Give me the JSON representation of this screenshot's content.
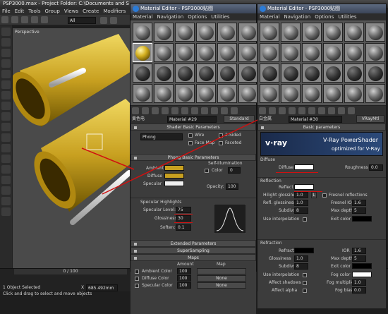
{
  "main": {
    "title": "PSP3000.max    - Project Folder: C:\\Documents and S",
    "menu": [
      "File",
      "Edit",
      "Tools",
      "Group",
      "Views",
      "Create",
      "Modifiers",
      "rea"
    ],
    "viewport_label": "Perspective",
    "view_dropdown": "All"
  },
  "status": {
    "selected": "1 Object Selected",
    "hint": "Click and drag to select and move objects",
    "timeline": "0 / 100",
    "x_value": "685.492mm",
    "x_label": "X"
  },
  "editor1": {
    "title": "Material Editor - PSP3000贴图",
    "menu": [
      "Material",
      "Navigation",
      "Options",
      "Utilities"
    ],
    "name": "黄色电",
    "material": "Material #29",
    "type": "Standard",
    "shader": {
      "header": "Shader Basic Parameters",
      "shader": "Phong",
      "wire": "Wire",
      "two_sided": "2-Sided",
      "face_map": "Face Map",
      "faceted": "Faceted"
    },
    "basic": {
      "header": "Phong Basic Parameters",
      "self_illum": "Self-Illumination",
      "color": "Color",
      "color_val": "0",
      "ambient": "Ambient",
      "diffuse": "Diffuse",
      "specular": "Specular",
      "opacity": "Opacity:",
      "opacity_val": "100"
    },
    "spec": {
      "header": "Specular Highlights",
      "level": "Specular Level:",
      "level_val": "75",
      "gloss": "Glossiness:",
      "gloss_val": "30",
      "soften": "Soften:",
      "soften_val": "0.1"
    },
    "extended": "Extended Parameters",
    "supersampling": "SuperSampling",
    "maps": {
      "header": "Maps",
      "amount": "Amount",
      "map": "Map",
      "rows": [
        {
          "label": "Ambient Color",
          "val": "100",
          "map": ""
        },
        {
          "label": "Diffuse Color",
          "val": "100",
          "map": "None"
        },
        {
          "label": "Specular Color",
          "val": "100",
          "map": "None"
        }
      ]
    }
  },
  "editor2": {
    "title": "Material Editor - PSP3000贴图",
    "menu": [
      "Material",
      "Navigation",
      "Options",
      "Utilities"
    ],
    "name": "白金属",
    "material": "Material #30",
    "type": "VRayMtl",
    "header": "Basic parameters",
    "vray_title": "V-Ray PowerShader",
    "vray_sub": "optimized for V-Ray",
    "vray_logo": "v·ray",
    "diffuse": {
      "section": "Diffuse",
      "label": "Diffuse",
      "rough": "Roughness",
      "rough_val": "0.0"
    },
    "reflection": {
      "section": "Reflection",
      "reflect": "Reflect",
      "hilight": "Hilight glossiness",
      "hilight_val": "1.0",
      "l": "L",
      "fresnel": "Fresnel reflections",
      "refl_gloss": "Refl. glossiness",
      "refl_gloss_val": "1.0",
      "fresnel_ior": "Fresnel IOR",
      "fresnel_ior_val": "1.6",
      "subdivs": "Subdivs",
      "subdivs_val": "8",
      "max_depth": "Max depth",
      "max_depth_val": "5",
      "use_interp": "Use interpolation",
      "exit_color": "Exit color"
    },
    "refraction": {
      "section": "Refraction",
      "refract": "Refract",
      "ior": "IOR",
      "ior_val": "1.6",
      "glossiness": "Glossiness",
      "gloss_val": "1.0",
      "max_depth": "Max depth",
      "max_depth_val": "5",
      "subdivs": "Subdivs",
      "subdivs_val": "8",
      "exit_color": "Exit color",
      "use_interp": "Use interpolation",
      "fog_color": "Fog color",
      "affect_shadows": "Affect shadows",
      "fog_mult": "Fog multiplier",
      "fog_mult_val": "1.0",
      "affect_alpha": "Affect alpha",
      "fog_bias": "Fog bias",
      "fog_bias_val": "0.0"
    }
  },
  "colors": {
    "gold": "#c8a020",
    "accent_red": "#d01010",
    "title_blue": "#3a4457"
  }
}
